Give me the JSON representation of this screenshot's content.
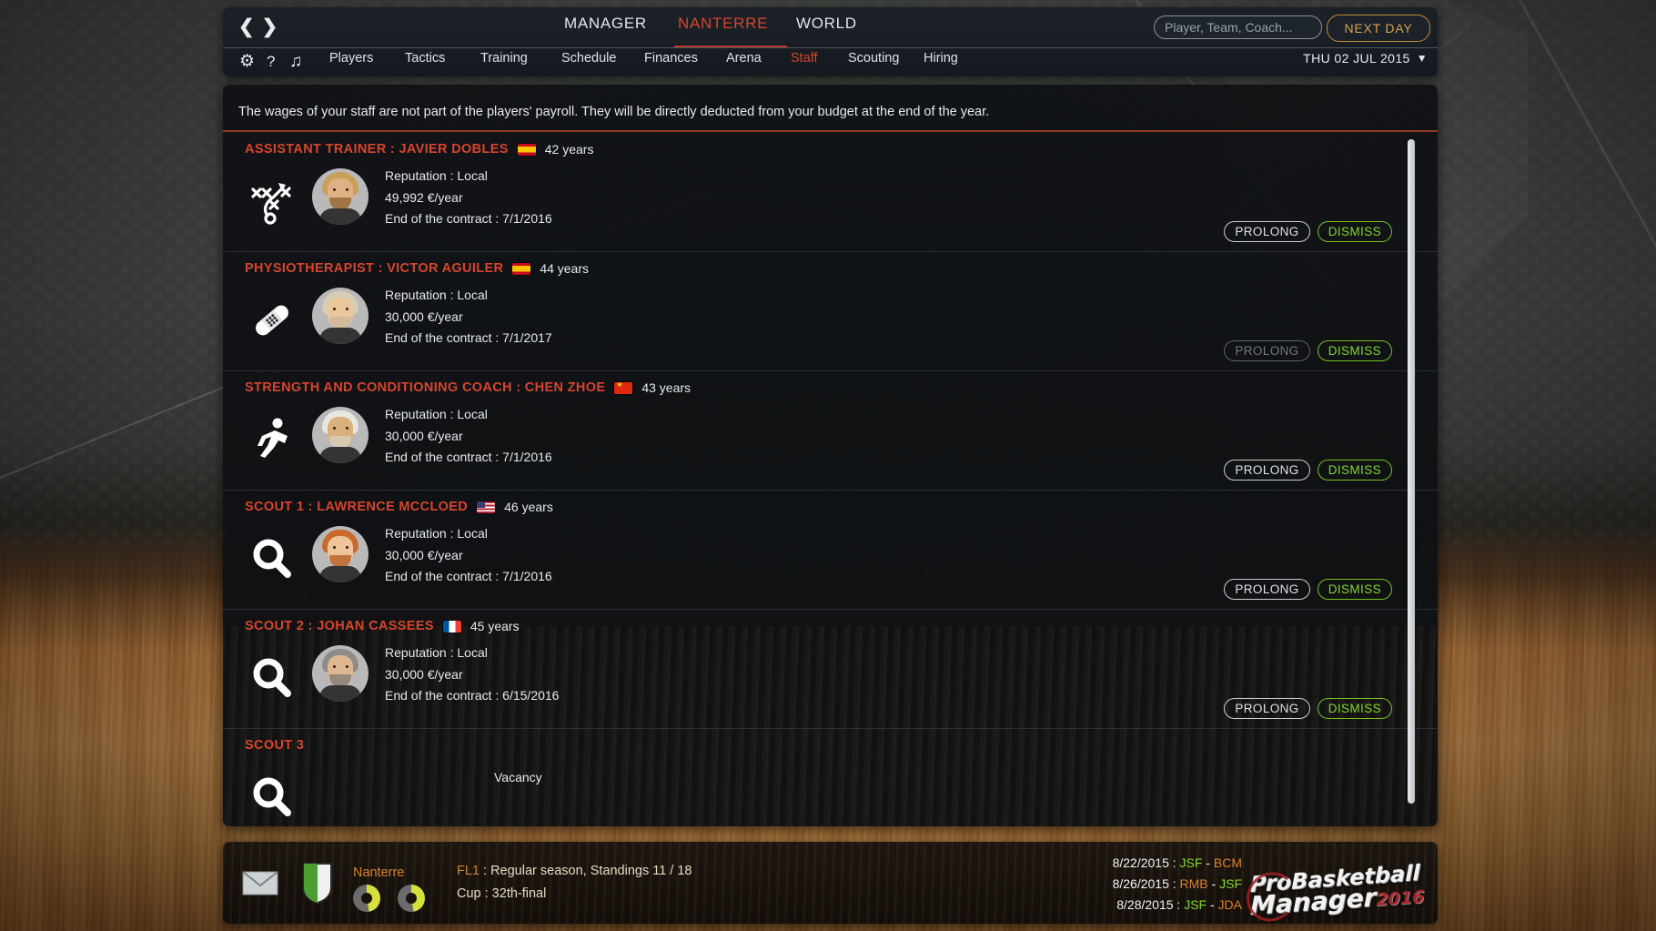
{
  "header": {
    "nav_prev_icon": "chevron-left-icon",
    "nav_next_icon": "chevron-right-icon",
    "main_tabs": [
      {
        "label": "MANAGER",
        "active": false
      },
      {
        "label": "NANTERRE",
        "active": true
      },
      {
        "label": "WORLD",
        "active": false
      }
    ],
    "search_placeholder": "Player, Team, Coach...",
    "search_value": "",
    "next_day_label": "NEXT DAY",
    "date_label": "THU 02 JUL 2015",
    "date_chevron": "chevron-down-icon",
    "sub_icons": [
      {
        "name": "gear-icon",
        "glyph": "⚙"
      },
      {
        "name": "help-icon",
        "glyph": "?"
      },
      {
        "name": "music-icon",
        "glyph": "♫"
      }
    ],
    "sub_tabs": [
      {
        "label": "Players",
        "active": false
      },
      {
        "label": "Tactics",
        "active": false
      },
      {
        "label": "Training",
        "active": false
      },
      {
        "label": "Schedule",
        "active": false
      },
      {
        "label": "Finances",
        "active": false
      },
      {
        "label": "Arena",
        "active": false
      },
      {
        "label": "Staff",
        "active": true
      },
      {
        "label": "Scouting",
        "active": false
      },
      {
        "label": "Hiring",
        "active": false
      }
    ]
  },
  "panel": {
    "notice": "The wages of your staff are not part of the players' payroll. They will be directly deducted from your budget at the end of the year.",
    "rows": [
      {
        "role": "ASSISTANT TRAINER : JAVIER DOBLES",
        "flag": "es",
        "age": "42 years",
        "role_icon": "playbook-icon",
        "reputation": "Reputation : Local",
        "wage": "49,992 €/year",
        "contract": "End of the contract : 7/1/2016",
        "prolong_label": "PROLONG",
        "dismiss_label": "DISMISS",
        "prolong_disabled": false,
        "hair": "#c8a05a",
        "skin": "#e0b184",
        "beard": "#8a6230"
      },
      {
        "role": "PHYSIOTHERAPIST : VICTOR AGUILER",
        "flag": "es",
        "age": "44 years",
        "role_icon": "bandage-icon",
        "reputation": "Reputation : Local",
        "wage": "30,000 €/year",
        "contract": "End of the contract : 7/1/2017",
        "prolong_label": "PROLONG",
        "dismiss_label": "DISMISS",
        "prolong_disabled": true,
        "hair": "#d8cdb4",
        "skin": "#e9c79b",
        "beard": "#c8b79a"
      },
      {
        "role": "STRENGTH AND CONDITIONING COACH : CHEN ZHOE",
        "flag": "cn",
        "age": "43 years",
        "role_icon": "runner-icon",
        "reputation": "Reputation : Local",
        "wage": "30,000 €/year",
        "contract": "End of the contract : 7/1/2016",
        "prolong_label": "PROLONG",
        "dismiss_label": "DISMISS",
        "prolong_disabled": false,
        "hair": "#e8e6e0",
        "skin": "#d8b17c",
        "beard": "#d8d2c4"
      },
      {
        "role": "SCOUT 1 : LAWRENCE MCCLOED",
        "flag": "us",
        "age": "46 years",
        "role_icon": "magnifier-icon",
        "reputation": "Reputation : Local",
        "wage": "30,000 €/year",
        "contract": "End of the contract : 7/1/2016",
        "prolong_label": "PROLONG",
        "dismiss_label": "DISMISS",
        "prolong_disabled": false,
        "hair": "#c96a2c",
        "skin": "#eec49a",
        "beard": "#b4551f"
      },
      {
        "role": "SCOUT 2 : JOHAN CASSEES",
        "flag": "fr",
        "age": "45 years",
        "role_icon": "magnifier-icon",
        "reputation": "Reputation : Local",
        "wage": "30,000 €/year",
        "contract": "End of the contract : 6/15/2016",
        "prolong_label": "PROLONG",
        "dismiss_label": "DISMISS",
        "prolong_disabled": false,
        "hair": "#8f8c88",
        "skin": "#ddb78f",
        "beard": "#7e7a74"
      },
      {
        "role": "SCOUT 3",
        "flag": "",
        "age": "",
        "role_icon": "magnifier-icon",
        "vacancy_label": "Vacancy"
      }
    ],
    "scrollbar": "vertical-scrollbar"
  },
  "status": {
    "mail_icon": "mail-icon",
    "shield_icon": "team-shield-icon",
    "team": "Nanterre",
    "league": "FL1 : Regular season, Standings 11 / 18",
    "league_prefix": "FL1",
    "league_rest": " : Regular season, Standings 11 / 18",
    "cup": "Cup : 32th-final",
    "matches": [
      {
        "date": "8/22/2015 : ",
        "home": "JSF",
        "sep": " - ",
        "away": "BCM",
        "home_green": true
      },
      {
        "date": "8/26/2015 : ",
        "home": "RMB",
        "sep": " - ",
        "away": "JSF",
        "home_green": false
      },
      {
        "date": "8/28/2015 : ",
        "home": "JSF",
        "sep": " - ",
        "away": "JDA",
        "home_green": true
      }
    ],
    "logo": {
      "line1_pro": "Pro",
      "line1_rest": "Basketball",
      "line2": "Manager",
      "year": "2016"
    }
  }
}
